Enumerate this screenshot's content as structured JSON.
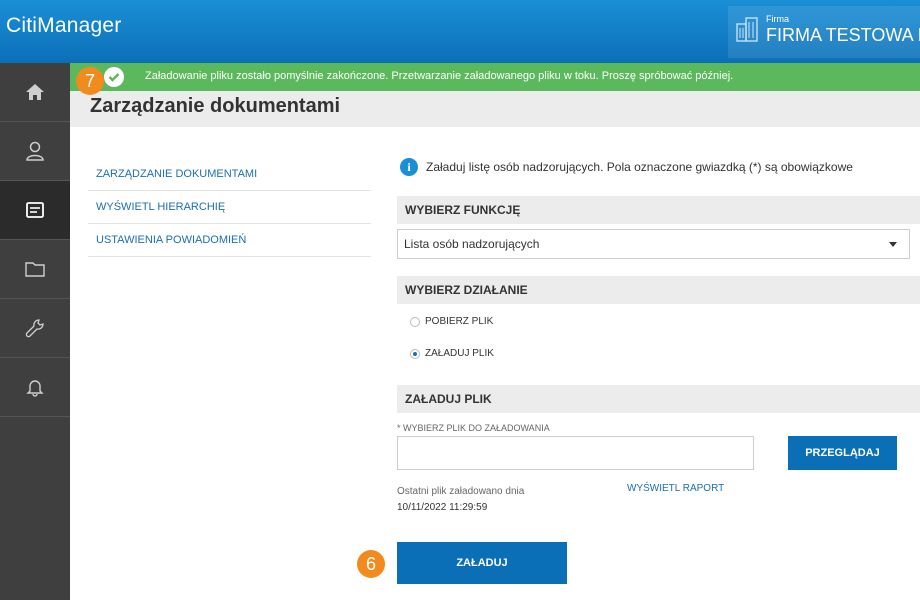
{
  "app": {
    "title": "CitiManager"
  },
  "firm": {
    "label": "Firma",
    "name": "FIRMA TESTOWA E"
  },
  "notification": {
    "text": "Załadowanie pliku zostało pomyślnie zakończone. Przetwarzanie załadowanego pliku w toku. Proszę spróbować później.",
    "step": "7"
  },
  "page": {
    "title": "Zarządzanie dokumentami"
  },
  "sidebar": {
    "items": [
      {
        "icon": "home-icon"
      },
      {
        "icon": "user-icon"
      },
      {
        "icon": "document-icon",
        "active": true
      },
      {
        "icon": "folder-icon"
      },
      {
        "icon": "wrench-icon"
      },
      {
        "icon": "bell-icon"
      }
    ]
  },
  "menu": {
    "items": [
      {
        "label": "ZARZĄDZANIE DOKUMENTAMI"
      },
      {
        "label": "WYŚWIETL HIERARCHIĘ"
      },
      {
        "label": "USTAWIENIA POWIADOMIEŃ"
      }
    ]
  },
  "form": {
    "info_text": "Załaduj listę osób nadzorujących. Pola oznaczone gwiazdką (*) są obowiązkowe",
    "function_header": "WYBIERZ FUNKCJĘ",
    "function_value": "Lista osób nadzorujących",
    "action_header": "WYBIERZ DZIAŁANIE",
    "action_options": [
      {
        "label": "POBIERZ PLIK",
        "checked": false
      },
      {
        "label": "ZAŁADUJ PLIK",
        "checked": true
      }
    ],
    "upload_header": "ZAŁADUJ PLIK",
    "file_label": "* WYBIERZ PLIK DO ZAŁADOWANIA",
    "file_value": "",
    "browse_label": "PRZEGLĄDAJ",
    "last_upload_label": "Ostatni plik załadowano dnia",
    "last_upload_date": "10/11/2022 11:29:59",
    "report_link": "WYŚWIETL RAPORT",
    "submit_label": "ZAŁADUJ",
    "submit_step": "6"
  },
  "colors": {
    "header": "#0b6fb8",
    "success": "#5cb85c",
    "badge": "#f28b1e",
    "sidebar": "#3f3f3f"
  }
}
